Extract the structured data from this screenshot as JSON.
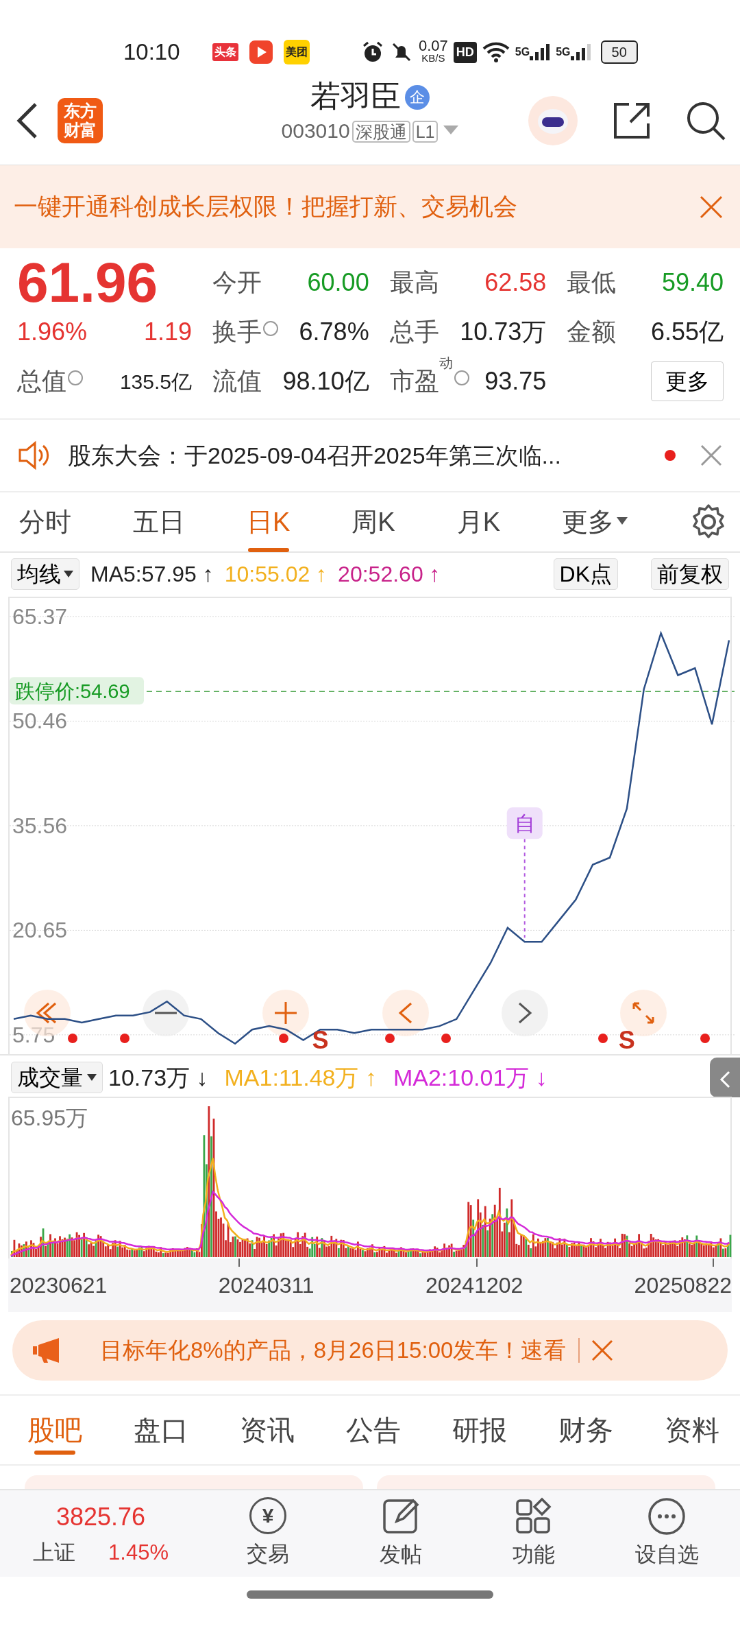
{
  "status_bar": {
    "time": "10:10",
    "notifications": [
      {
        "kind": "toutiao",
        "text": "头条"
      },
      {
        "kind": "video"
      },
      {
        "kind": "meituan",
        "text": "美团"
      }
    ],
    "net_speed": "0.07",
    "net_unit": "KB/S",
    "hd_label": "HD",
    "signals": [
      {
        "label": "5G"
      },
      {
        "label": "5G"
      }
    ],
    "battery": "50"
  },
  "header": {
    "logo_text": [
      "东方",
      "财富"
    ],
    "title": "若羽臣",
    "title_badge": "企",
    "code": "003010",
    "tags": [
      "深股通",
      "L1"
    ]
  },
  "promo_banner": {
    "text": "一键开通科创成长层权限！把握打新、交易机会"
  },
  "quote": {
    "price": "61.96",
    "color": "#e53431",
    "change_pct": "1.96%",
    "change": "1.19",
    "stats": [
      {
        "label": "今开",
        "value": "60.00",
        "color": "#179b24",
        "info": false
      },
      {
        "label": "最高",
        "value": "62.58",
        "color": "#e53431",
        "info": false
      },
      {
        "label": "最低",
        "value": "59.40",
        "color": "#179b24",
        "info": false
      },
      {
        "label": "换手",
        "value": "6.78%",
        "color": "#222222",
        "info": true
      },
      {
        "label": "总手",
        "value": "10.73万",
        "color": "#222222",
        "info": false
      },
      {
        "label": "金额",
        "value": "6.55亿",
        "color": "#222222",
        "info": false
      },
      {
        "label": "流值",
        "value": "98.10亿",
        "color": "#222222",
        "info": false
      },
      {
        "label": "市盈",
        "sup": "动",
        "value": "93.75",
        "color": "#222222",
        "info": true
      }
    ],
    "market_cap": {
      "label": "总值",
      "value": "135.5亿",
      "info": true
    },
    "more_button": "更多"
  },
  "notice": {
    "text": "股东大会：于2025-09-04召开2025年第三次临...",
    "unread": true
  },
  "chart_tabs": [
    {
      "label": "分时",
      "selected": false,
      "dropdown": false
    },
    {
      "label": "五日",
      "selected": false,
      "dropdown": false
    },
    {
      "label": "日K",
      "selected": true,
      "dropdown": false
    },
    {
      "label": "周K",
      "selected": false,
      "dropdown": false
    },
    {
      "label": "月K",
      "selected": false,
      "dropdown": false
    },
    {
      "label": "更多",
      "selected": false,
      "dropdown": true
    }
  ],
  "indicator_bar": {
    "dropdown": "均线",
    "averages": [
      {
        "text": "MA5:57.95",
        "arrow": "↑",
        "color": "#222222"
      },
      {
        "text": "10:55.02",
        "arrow": "↑",
        "color": "#f2b01e"
      },
      {
        "text": "20:52.60",
        "arrow": "↑",
        "color": "#c8238a"
      }
    ],
    "dk_button": "DK点",
    "adjust_button": "前复权"
  },
  "price_chart": {
    "chart_data": {
      "type": "line",
      "yticks": [
        5.75,
        20.65,
        35.56,
        50.46,
        65.37
      ],
      "ylim": [
        3,
        68
      ],
      "values": [
        8,
        8.5,
        8,
        8,
        7.5,
        8,
        8.5,
        8.5,
        9,
        10.5,
        8.5,
        8,
        6,
        4.5,
        6.5,
        7,
        6.5,
        5,
        6.5,
        6.5,
        6,
        6.5,
        6.5,
        6.5,
        6.5,
        7,
        8,
        12,
        16,
        21,
        19,
        19,
        22,
        25,
        30,
        31,
        38,
        55,
        63,
        57,
        58,
        50,
        62
      ],
      "grid": true,
      "ref_lines": [
        {
          "axis": "y",
          "value": 54.69,
          "label": "跌停价:54.69"
        }
      ]
    },
    "markers": [
      {
        "kind": "self",
        "text": "自"
      },
      {
        "kind": "signal",
        "text": "S"
      },
      {
        "kind": "signal",
        "text": "S"
      }
    ]
  },
  "volume": {
    "dropdown": "成交量",
    "value": "10.73万",
    "arrow": "↓",
    "averages": [
      {
        "text": "MA1:11.48万",
        "arrow": "↑",
        "color": "#f2b01e"
      },
      {
        "text": "MA2:10.01万",
        "arrow": "↓",
        "color": "#d42ad8"
      }
    ],
    "max_label": "65.95万"
  },
  "dates": [
    "20230621",
    "20240311",
    "20241202",
    "20250822"
  ],
  "ad_banner": {
    "text": "目标年化8%的产品，8月26日15:00发车！速看"
  },
  "section_tabs": [
    {
      "label": "股吧",
      "selected": true
    },
    {
      "label": "盘口",
      "selected": false
    },
    {
      "label": "资讯",
      "selected": false
    },
    {
      "label": "公告",
      "selected": false
    },
    {
      "label": "研报",
      "selected": false
    },
    {
      "label": "财务",
      "selected": false
    },
    {
      "label": "资料",
      "selected": false
    }
  ],
  "bottom_nav": {
    "index": {
      "value": "3825.76",
      "name": "上证",
      "change_pct": "1.45%",
      "color": "#e53431"
    },
    "items": [
      {
        "kind": "trade",
        "label": "交易",
        "icon_text": "¥"
      },
      {
        "kind": "post",
        "label": "发帖"
      },
      {
        "kind": "functions",
        "label": "功能"
      },
      {
        "kind": "watchlist",
        "label": "设自选"
      }
    ]
  }
}
